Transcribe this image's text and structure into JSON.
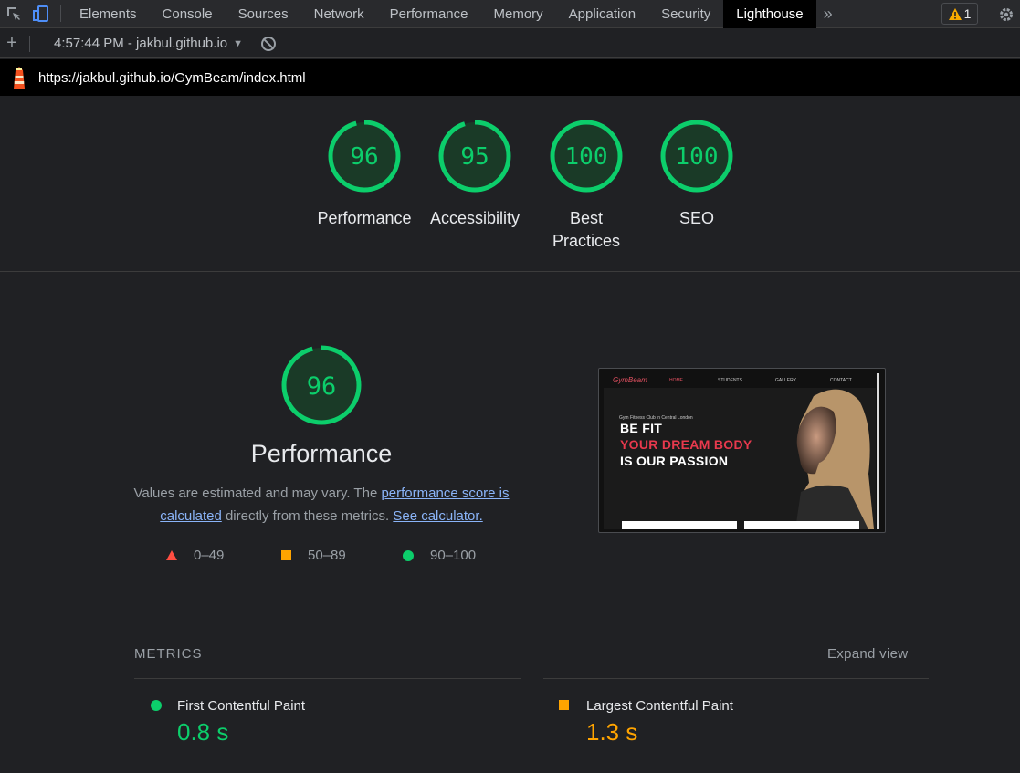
{
  "devtools": {
    "tabs": [
      "Elements",
      "Console",
      "Sources",
      "Network",
      "Performance",
      "Memory",
      "Application",
      "Security",
      "Lighthouse"
    ],
    "active_tab": "Lighthouse",
    "warning_count": "1",
    "report_label": "4:57:44 PM - jakbul.github.io"
  },
  "url": "https://jakbul.github.io/GymBeam/index.html",
  "gauges": [
    {
      "score": "96",
      "label": "Performance",
      "value": 96
    },
    {
      "score": "95",
      "label": "Accessibility",
      "value": 95
    },
    {
      "score": "100",
      "label": "Best Practices",
      "value": 100
    },
    {
      "score": "100",
      "label": "SEO",
      "value": 100
    }
  ],
  "performance": {
    "score": "96",
    "title": "Performance",
    "desc_pre": "Values are estimated and may vary. The ",
    "link1": "performance score is calculated",
    "desc_mid": " directly from these metrics. ",
    "link2": "See calculator.",
    "legend": [
      "0–49",
      "50–89",
      "90–100"
    ]
  },
  "thumbnail": {
    "logo": "GymBeam",
    "nav": [
      "HOME",
      "STUDENTS",
      "GALLERY",
      "CONTACT"
    ],
    "subtitle": "Gym Fitness Club in Central London",
    "line1": "BE FIT",
    "line2": "YOUR DREAM BODY",
    "line3": "IS OUR PASSION"
  },
  "metrics": {
    "heading": "METRICS",
    "expand_label": "Expand view",
    "items": [
      {
        "name": "First Contentful Paint",
        "value": "0.8 s",
        "status": "pass"
      },
      {
        "name": "Largest Contentful Paint",
        "value": "1.3 s",
        "status": "average"
      }
    ]
  },
  "colors": {
    "pass": "#0cce6b",
    "average": "#ffa400",
    "fail": "#ff4e42"
  }
}
